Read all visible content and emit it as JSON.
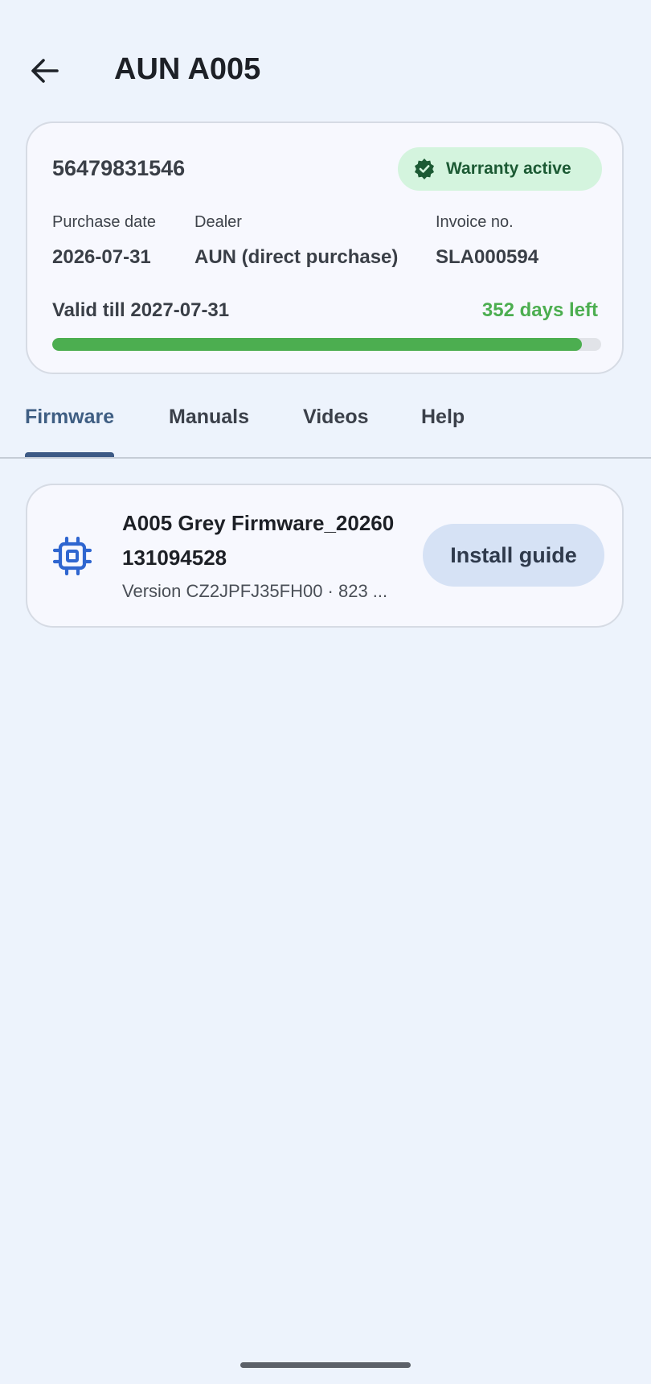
{
  "app_bar": {
    "title": "AUN A005"
  },
  "warranty": {
    "serial": "56479831546",
    "badge": "Warranty active",
    "purchase_date_label": "Purchase date",
    "purchase_date": "2026-07-31",
    "dealer_label": "Dealer",
    "dealer": "AUN (direct purchase)",
    "invoice_label": "Invoice no.",
    "invoice": "SLA000594",
    "valid_till": "Valid till 2027-07-31",
    "days_left": "352 days left",
    "remaining_fraction": 0.965
  },
  "tabs": [
    {
      "label": "Firmware",
      "active": true
    },
    {
      "label": "Manuals",
      "active": false
    },
    {
      "label": "Videos",
      "active": false
    },
    {
      "label": "Help",
      "active": false
    }
  ],
  "firmware": {
    "name": "A005 Grey Firmware_20260131094528",
    "meta": "Version CZ2JPFJ35FH00 · 823 ...",
    "install_label": "Install guide"
  },
  "colors": {
    "background": "#edf3fc",
    "accent_green": "#4cae50",
    "tab_active": "#3f5e83",
    "chip_icon": "#2f66d0"
  },
  "icons": {
    "back": "arrow-left-icon",
    "badge": "verified-check-icon",
    "firmware": "memory-chip-icon"
  }
}
